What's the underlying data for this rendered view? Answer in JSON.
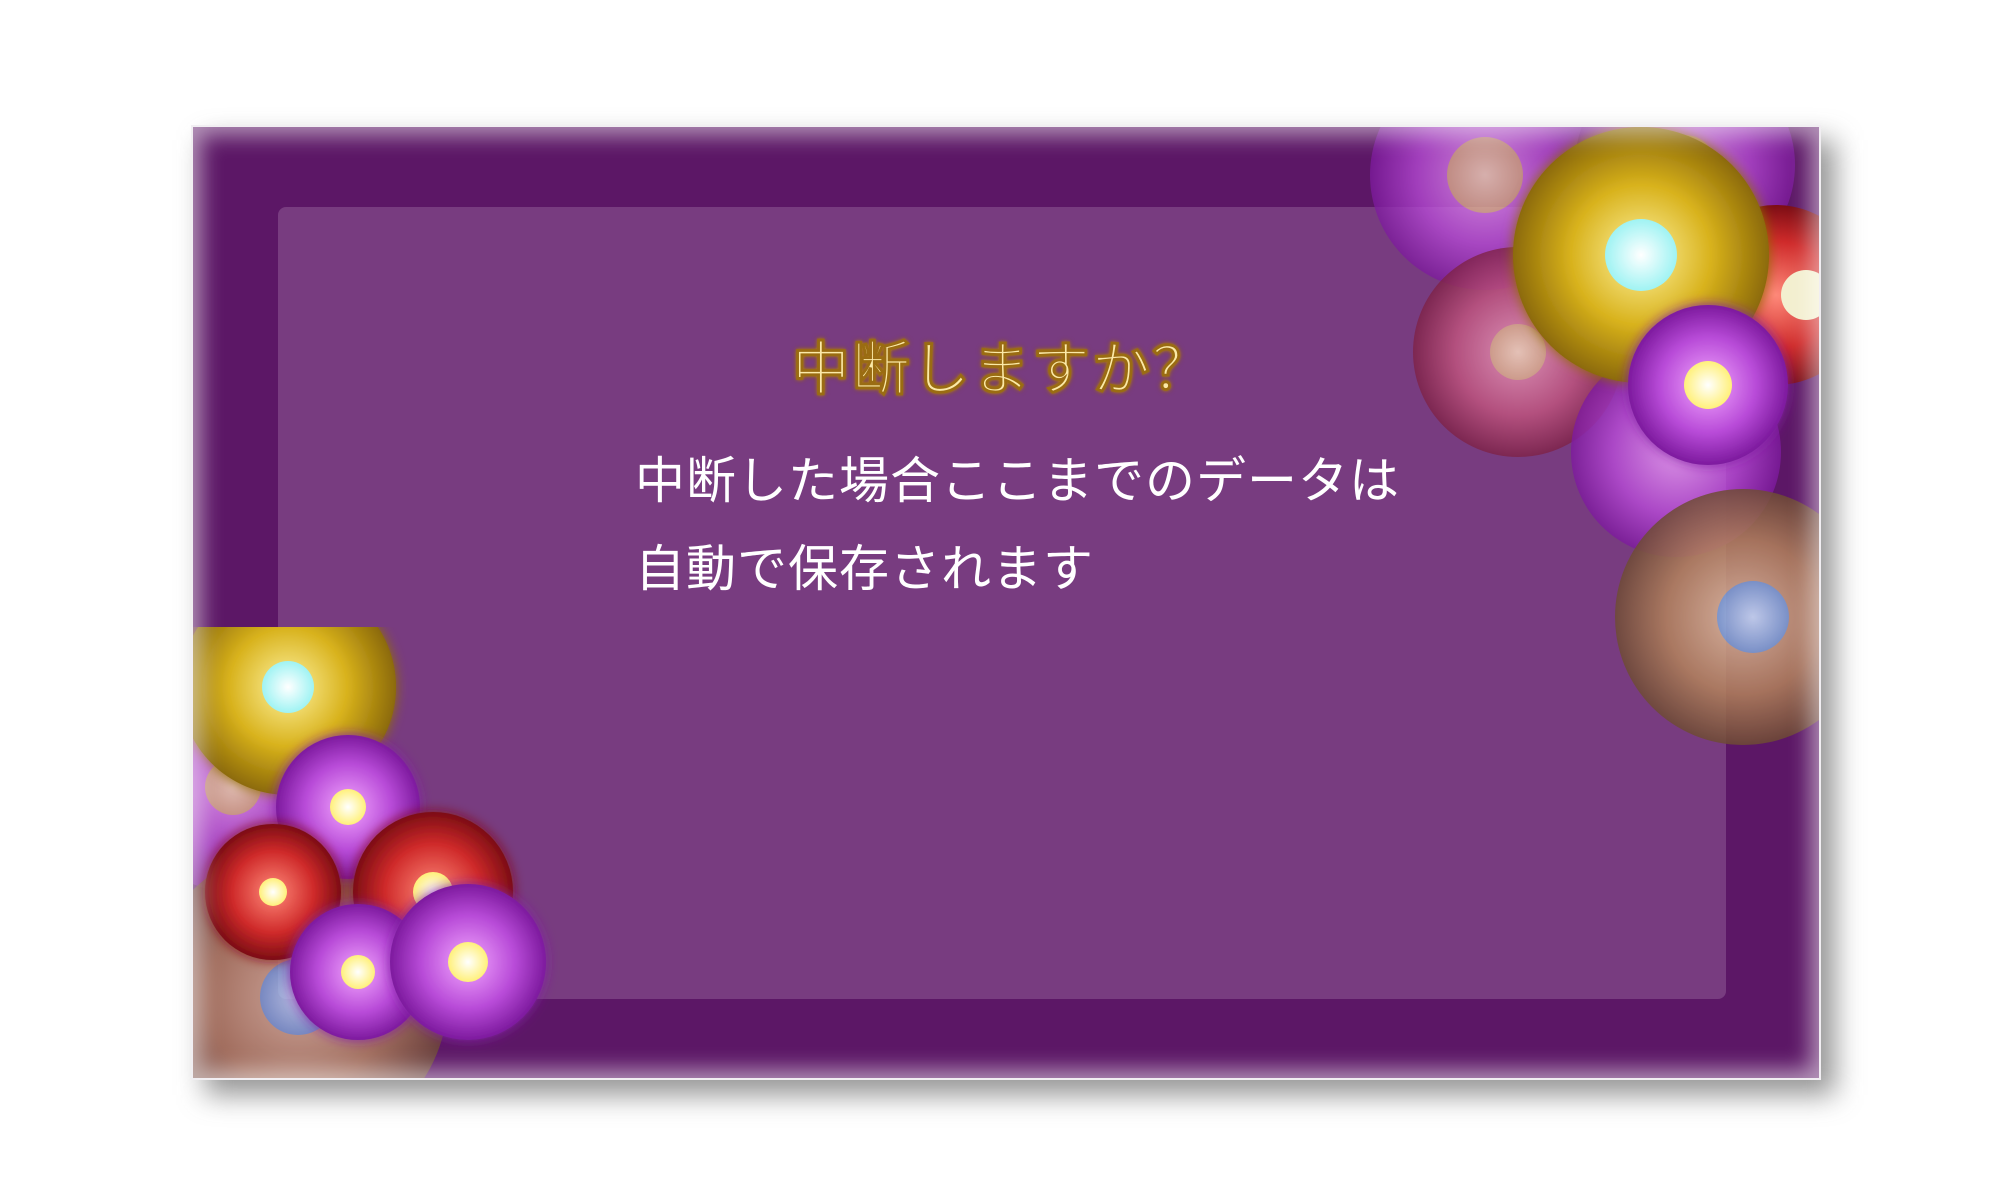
{
  "dialog": {
    "title": "中断しますか？",
    "message_lines": [
      "中断した場合ここまでのデータは",
      "自動で保存されます"
    ]
  },
  "colors": {
    "frame": "#5c1766",
    "panel": "#783c80",
    "title_text": "#fbe9a7",
    "message_text": "#ffffff"
  },
  "decorations": {
    "top_right": "chrysanthemum-cluster",
    "bottom_left": "chrysanthemum-cluster"
  }
}
